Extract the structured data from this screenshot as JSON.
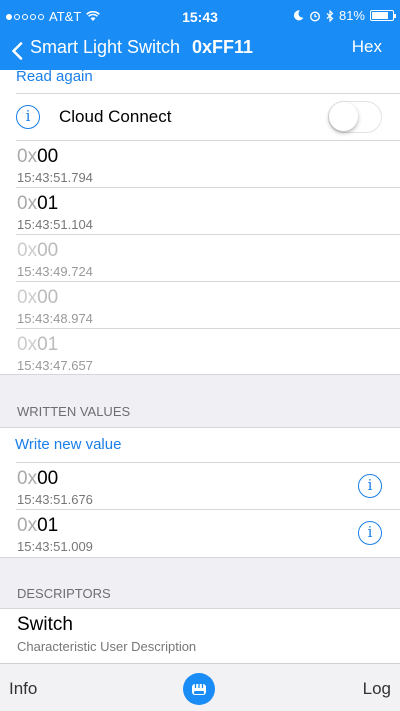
{
  "status": {
    "carrier": "AT&T",
    "time": "15:43",
    "battery_pct": "81%",
    "battery_level": 0.81
  },
  "nav": {
    "back_title": "Smart Light Switch",
    "characteristic_id": "0xFF11",
    "format": "Hex"
  },
  "read": {
    "read_again": "Read again",
    "cloud_connect": "Cloud Connect",
    "cloud_connect_on": false,
    "values": [
      {
        "prefix": "0x",
        "value": "00",
        "time": "15:43:51.794"
      },
      {
        "prefix": "0x",
        "value": "01",
        "time": "15:43:51.104"
      },
      {
        "prefix": "0x",
        "value": "00",
        "time": "15:43:49.724"
      },
      {
        "prefix": "0x",
        "value": "00",
        "time": "15:43:48.974"
      },
      {
        "prefix": "0x",
        "value": "01",
        "time": "15:43:47.657"
      }
    ]
  },
  "written": {
    "header": "WRITTEN VALUES",
    "write_new": "Write new value",
    "values": [
      {
        "prefix": "0x",
        "value": "00",
        "time": "15:43:51.676"
      },
      {
        "prefix": "0x",
        "value": "01",
        "time": "15:43:51.009"
      }
    ]
  },
  "descriptors": {
    "header": "DESCRIPTORS",
    "items": [
      {
        "title": "Switch",
        "subtitle": "Characteristic User Description"
      }
    ]
  },
  "tabs": {
    "left": "Info",
    "right": "Log"
  },
  "colors": {
    "accent": "#1a8cf5",
    "link": "#1a7fe8"
  }
}
